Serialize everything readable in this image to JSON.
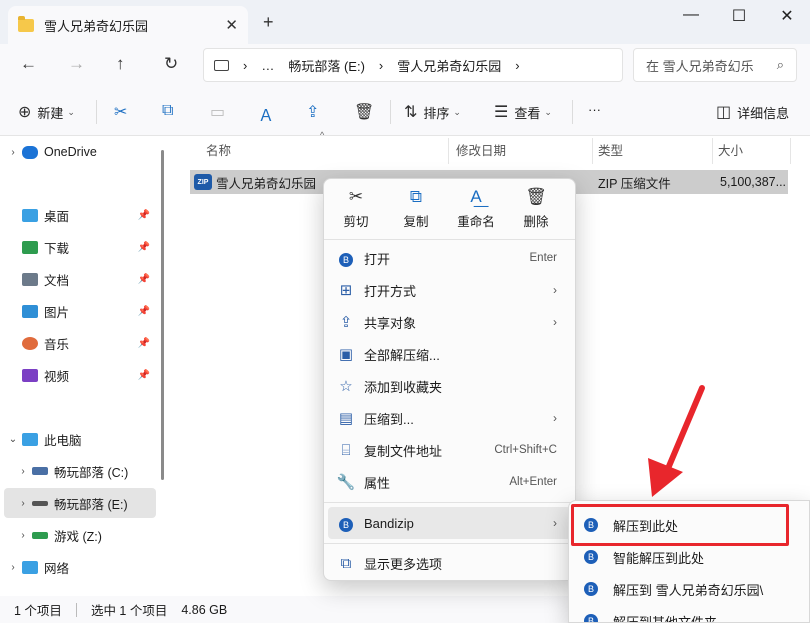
{
  "window": {
    "tab_title": "雪人兄弟奇幻乐园",
    "tab_close": "✕",
    "new_tab": "+",
    "minimize": "—",
    "maximize": "☐",
    "close": "✕"
  },
  "nav": {
    "back": "←",
    "forward": "→",
    "up": "↑",
    "refresh": "↻",
    "breadcrumb": [
      "›",
      "…",
      "畅玩部落 (E:)",
      "›",
      "雪人兄弟奇幻乐园",
      "›"
    ],
    "search_placeholder": "在 雪人兄弟奇幻乐",
    "search_icon": "⌕"
  },
  "toolbar": {
    "new_label": "新建",
    "sort_label": "排序",
    "view_label": "查看",
    "more": "···",
    "details_label": "详细信息"
  },
  "sidebar": {
    "items": [
      {
        "label": "OneDrive",
        "icon": "cloud-icon",
        "color": "#1b73d6"
      },
      {
        "label": "桌面",
        "icon": "desktop-icon",
        "color": "#3aa0e3"
      },
      {
        "label": "下载",
        "icon": "download-icon",
        "color": "#2e9c4f"
      },
      {
        "label": "文档",
        "icon": "document-icon",
        "color": "#6c7a8a"
      },
      {
        "label": "图片",
        "icon": "pictures-icon",
        "color": "#2f8fd6"
      },
      {
        "label": "音乐",
        "icon": "music-icon",
        "color": "#e06b3c"
      },
      {
        "label": "视频",
        "icon": "video-icon",
        "color": "#7b3fc4"
      },
      {
        "label": "此电脑",
        "icon": "pc-icon",
        "color": "#3aa0e3"
      },
      {
        "label": "畅玩部落 (C:)",
        "icon": "drive-c-icon",
        "color": "#4a6fa5"
      },
      {
        "label": "畅玩部落 (E:)",
        "icon": "drive-e-icon",
        "color": "#555555"
      },
      {
        "label": "游戏 (Z:)",
        "icon": "drive-z-icon",
        "color": "#2e9c4f"
      },
      {
        "label": "网络",
        "icon": "network-icon",
        "color": "#3aa0e3"
      }
    ]
  },
  "columns": {
    "name": "名称",
    "date": "修改日期",
    "type": "类型",
    "size": "大小"
  },
  "file": {
    "name": "雪人兄弟奇幻乐园",
    "type": "ZIP 压缩文件",
    "size": "5,100,387..."
  },
  "context_menu": {
    "actions": [
      {
        "label": "剪切",
        "icon": "✂"
      },
      {
        "label": "复制",
        "icon": "⧉"
      },
      {
        "label": "重命名",
        "icon": "A͟"
      },
      {
        "label": "删除",
        "icon": "🗑"
      }
    ],
    "items": [
      {
        "label": "打开",
        "shortcut": "Enter",
        "arrow": ""
      },
      {
        "label": "打开方式",
        "shortcut": "",
        "arrow": "›"
      },
      {
        "label": "共享对象",
        "shortcut": "",
        "arrow": "›"
      },
      {
        "label": "全部解压缩...",
        "shortcut": "",
        "arrow": ""
      },
      {
        "label": "添加到收藏夹",
        "shortcut": "",
        "arrow": ""
      },
      {
        "label": "压缩到...",
        "shortcut": "",
        "arrow": "›"
      },
      {
        "label": "复制文件地址",
        "shortcut": "Ctrl+Shift+C",
        "arrow": ""
      },
      {
        "label": "属性",
        "shortcut": "Alt+Enter",
        "arrow": ""
      },
      {
        "label": "Bandizip",
        "shortcut": "",
        "arrow": "›"
      },
      {
        "label": "显示更多选项",
        "shortcut": "",
        "arrow": ""
      }
    ]
  },
  "submenu": {
    "items": [
      "解压到此处",
      "智能解压到此处",
      "解压到 雪人兄弟奇幻乐园\\",
      "解压到其他文件夹"
    ],
    "highlight_color": "#e8262c"
  },
  "status": {
    "item_count": "1 个项目",
    "selected": "选中 1 个项目",
    "selected_size": "4.86 GB"
  }
}
